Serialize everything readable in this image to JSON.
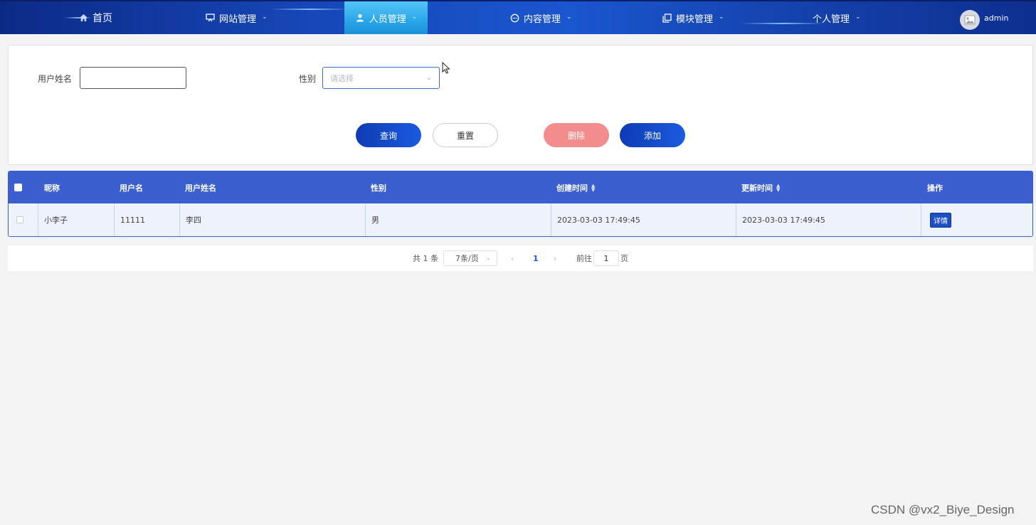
{
  "nav": {
    "home": "首页",
    "website_mgmt": "网站管理",
    "staff_mgmt": "人员管理",
    "content_mgmt": "内容管理",
    "module_mgmt": "模块管理",
    "personal_mgmt": "个人管理",
    "user": "admin",
    "active_item": "人员管理",
    "active_color": "#2aa6e8"
  },
  "search": {
    "username_label": "用户姓名",
    "username_value": "",
    "gender_label": "性别",
    "gender_placeholder": "请选择"
  },
  "buttons": {
    "query": "查询",
    "reset": "重置",
    "delete": "删除",
    "add": "添加"
  },
  "table": {
    "headers": [
      "昵称",
      "用户名",
      "用户姓名",
      "性别",
      "创建时间",
      "更新时间",
      "操作"
    ],
    "rows": [
      {
        "nickname": "小李子",
        "username": "11111",
        "realname": "李四",
        "gender": "男",
        "created": "2023-03-03 17:49:45",
        "updated": "2023-03-03 17:49:45",
        "action": "详情"
      }
    ]
  },
  "pagination": {
    "total": "共 1 条",
    "page_size": "7条/页",
    "current_page": "1",
    "goto_label": "前往",
    "goto_value": "1",
    "page_suffix": "页"
  },
  "watermark": "CSDN @vx2_Biye_Design",
  "colors": {
    "nav_bg": "#1747b8",
    "primary": "#1a5be0",
    "danger": "#f38c8c",
    "table_header": "#3b5fcf"
  }
}
